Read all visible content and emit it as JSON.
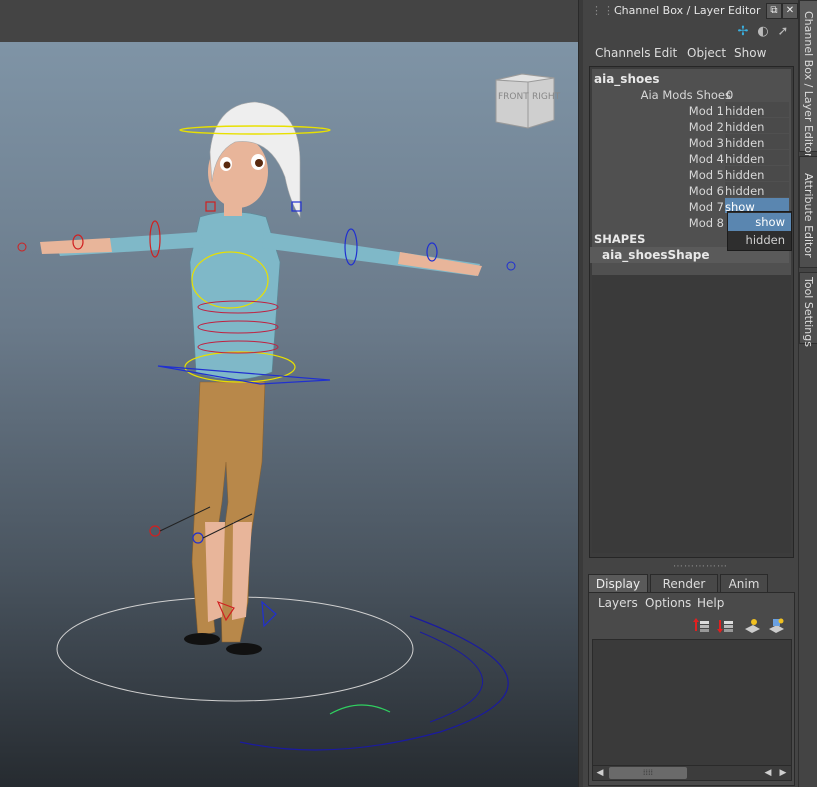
{
  "panel": {
    "title": "Channel Box / Layer Editor",
    "window_buttons": [
      "float-icon",
      "close-icon"
    ],
    "toolbar_icons": [
      "channel-box-icon",
      "layer-editor-icon",
      "attribute-icon"
    ]
  },
  "channel_box": {
    "menu": [
      "Channels",
      "Edit",
      "Object",
      "Show"
    ],
    "object_name": "aia_shoes",
    "channels": [
      {
        "label": "Aia Mods Shoes",
        "value": "0"
      },
      {
        "label": "Mod 1",
        "value": "hidden"
      },
      {
        "label": "Mod 2",
        "value": "hidden"
      },
      {
        "label": "Mod 3",
        "value": "hidden"
      },
      {
        "label": "Mod 4",
        "value": "hidden"
      },
      {
        "label": "Mod 5",
        "value": "hidden"
      },
      {
        "label": "Mod 6",
        "value": "hidden"
      },
      {
        "label": "Mod 7",
        "value": "show"
      },
      {
        "label": "Mod 8",
        "value": ""
      }
    ],
    "shapes_header": "SHAPES",
    "shape_name": "aia_shoesShape",
    "dropdown_options": [
      "show",
      "hidden"
    ],
    "dropdown_selected": "show"
  },
  "layer_editor": {
    "tabs": [
      "Display",
      "Render",
      "Anim"
    ],
    "active_tab": "Display",
    "menu": [
      "Layers",
      "Options",
      "Help"
    ],
    "icons": [
      "layer-move-up-icon",
      "layer-move-down-icon",
      "new-layer-icon",
      "new-layer-from-selected-icon"
    ]
  },
  "side_tabs": [
    "Channel Box / Layer Editor",
    "Attribute Editor",
    "Tool Settings"
  ],
  "viewport": {
    "view_cube": {
      "front": "FRONT",
      "right": "RIGHT"
    }
  },
  "colors": {
    "selection_blue": "#5a86b0",
    "panel_bg": "#444444",
    "control_red": "#d02020",
    "control_blue": "#2030d0",
    "control_yellow": "#e8e000",
    "control_green": "#30d060"
  }
}
